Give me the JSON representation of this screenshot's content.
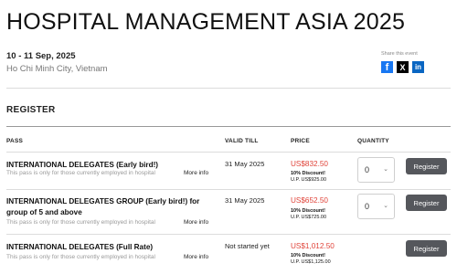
{
  "event": {
    "title": "HOSPITAL MANAGEMENT ASIA 2025",
    "date": "10 - 11 Sep, 2025",
    "location": "Ho Chi Minh City, Vietnam"
  },
  "share": {
    "label": "Share this event",
    "icons": [
      {
        "name": "facebook-icon",
        "glyph": "f",
        "color": "#1877f2"
      },
      {
        "name": "x-icon",
        "glyph": "X",
        "color": "#000000"
      },
      {
        "name": "linkedin-icon",
        "glyph": "in",
        "color": "#0a66c2"
      }
    ]
  },
  "register": {
    "heading": "REGISTER",
    "columns": {
      "pass": "PASS",
      "valid_till": "VALID TILL",
      "price": "PRICE",
      "quantity": "QUANTITY"
    },
    "button_label": "Register",
    "more_info_label": "More info",
    "passes": [
      {
        "name": "INTERNATIONAL DELEGATES (Early bird!)",
        "note": "This pass is only for those currently employed in hospital",
        "valid_till": "31 May 2025",
        "price": "US$832.50",
        "discount": "10% Discount!",
        "up": "U.P. US$925.00",
        "quantity": "0"
      },
      {
        "name": "INTERNATIONAL DELEGATES GROUP (Early bird!) for group of 5 and above",
        "note": "This pass is only for those currently employed in hospital",
        "valid_till": "31 May 2025",
        "price": "US$652.50",
        "discount": "10% Discount!",
        "up": "U.P. US$725.00",
        "quantity": "0"
      },
      {
        "name": "INTERNATIONAL DELEGATES (Full Rate)",
        "note": "This pass is only for those currently employed in hospital",
        "valid_till": "Not started yet",
        "price": "US$1,012.50",
        "discount": "10% Discount!",
        "up": "U.P. US$1,125.00",
        "quantity": null
      }
    ]
  },
  "colors": {
    "price_red": "#e0443a",
    "button_gray": "#55575c"
  }
}
